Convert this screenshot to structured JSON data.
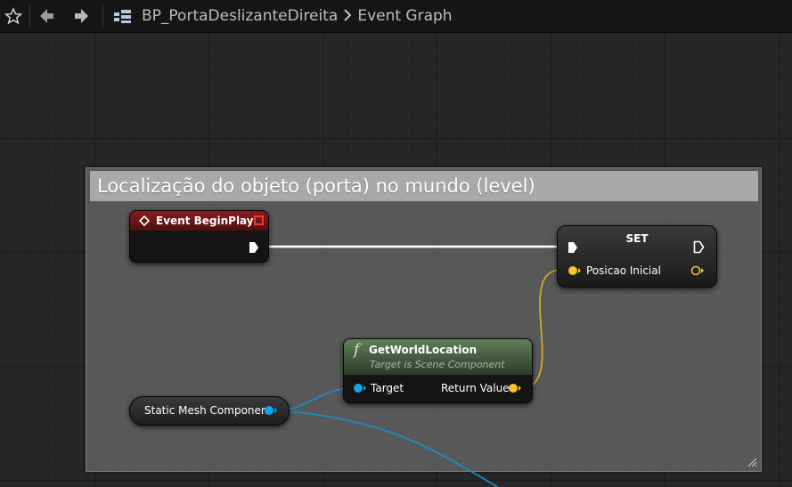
{
  "toolbar": {
    "blueprint_name": "BP_PortaDeslizanteDireita",
    "graph_name": "Event Graph",
    "icons": [
      "star-icon",
      "back-arrow-icon",
      "forward-arrow-icon",
      "blueprint-icon",
      "chevron-right-icon"
    ]
  },
  "comment": {
    "title": "Localização do objeto (porta) no mundo (level)"
  },
  "nodes": {
    "event_begin_play": {
      "title": "Event BeginPlay",
      "header_color": "#8a1c1c"
    },
    "set": {
      "title": "SET",
      "input_label": "Posicao Inicial"
    },
    "get_world_location": {
      "title": "GetWorldLocation",
      "subtitle": "Target is Scene Component",
      "input_label": "Target",
      "output_label": "Return Value",
      "header_color": "#5f7f59"
    },
    "static_mesh_component": {
      "label": "Static Mesh Component"
    }
  },
  "colors": {
    "exec_wire": "#ffffff",
    "vector_pin": "#f9c22b",
    "object_pin": "#0fa5e8"
  }
}
